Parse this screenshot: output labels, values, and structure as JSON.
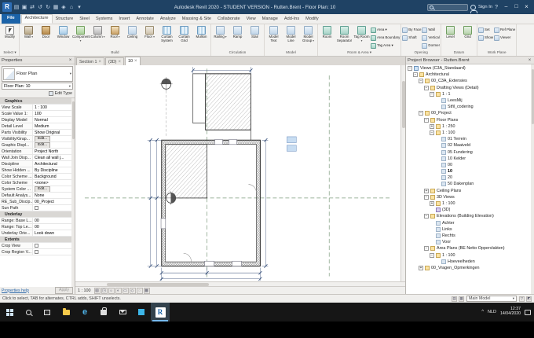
{
  "ui": {
    "close": "×",
    "dropdown": "▾",
    "help": "?"
  },
  "window": {
    "title": "Autodesk Revit 2020 - STUDENT VERSION - Rutten.Brent - Floor Plan: 10",
    "sign_in": "Sign In",
    "controls": {
      "minimize": "–",
      "maximize": "□",
      "close": "×"
    },
    "quick_access": [
      {
        "name": "revit-logo",
        "glyph": "R",
        "logo": true
      },
      {
        "name": "open-icon",
        "glyph": "▤"
      },
      {
        "name": "save-icon",
        "glyph": "▣"
      },
      {
        "name": "sync-icon",
        "glyph": "⇄"
      },
      {
        "name": "undo-icon",
        "glyph": "↺"
      },
      {
        "name": "redo-icon",
        "glyph": "↻"
      },
      {
        "name": "print-icon",
        "glyph": "▦"
      },
      {
        "name": "measure-icon",
        "glyph": "◈"
      },
      {
        "name": "home-icon",
        "glyph": "⌂"
      },
      {
        "name": "quick-access-dropdown-icon",
        "glyph": "▾"
      }
    ]
  },
  "ribbon": {
    "tabs": [
      {
        "label": "File",
        "style": "file"
      },
      {
        "label": "Architecture",
        "active": true
      },
      {
        "label": "Structure"
      },
      {
        "label": "Steel"
      },
      {
        "label": "Systems"
      },
      {
        "label": "Insert"
      },
      {
        "label": "Annotate"
      },
      {
        "label": "Analyze"
      },
      {
        "label": "Massing & Site"
      },
      {
        "label": "Collaborate"
      },
      {
        "label": "View"
      },
      {
        "label": "Manage"
      },
      {
        "label": "Add-Ins"
      },
      {
        "label": "Modify"
      }
    ],
    "panels": [
      {
        "label": "Select ▾",
        "columns": [
          {
            "type": "big",
            "buttons": [
              {
                "label": "Modify",
                "icon": "modify-cursor"
              }
            ]
          }
        ]
      },
      {
        "label": "Build",
        "columns": [
          {
            "type": "big",
            "buttons": [
              {
                "label": "Wall",
                "icon": "wall",
                "arrow": true
              }
            ]
          },
          {
            "type": "big",
            "buttons": [
              {
                "label": "Door",
                "icon": "door"
              }
            ]
          },
          {
            "type": "big",
            "buttons": [
              {
                "label": "Window",
                "icon": "window"
              }
            ]
          },
          {
            "type": "big",
            "buttons": [
              {
                "label": "Component",
                "icon": "component",
                "arrow": true
              }
            ]
          },
          {
            "type": "big",
            "buttons": [
              {
                "label": "Column",
                "icon": "column",
                "arrow": true
              }
            ]
          },
          {
            "type": "big",
            "buttons": [
              {
                "label": "Roof",
                "icon": "roof",
                "arrow": true
              }
            ]
          },
          {
            "type": "big",
            "buttons": [
              {
                "label": "Ceiling",
                "icon": "ceiling"
              }
            ]
          },
          {
            "type": "big",
            "buttons": [
              {
                "label": "Floor",
                "icon": "floor",
                "arrow": true
              }
            ]
          },
          {
            "type": "big",
            "buttons": [
              {
                "label": "Curtain System",
                "icon": "curtain-system"
              }
            ]
          },
          {
            "type": "big",
            "buttons": [
              {
                "label": "Curtain Grid",
                "icon": "curtain-grid"
              }
            ]
          },
          {
            "type": "big",
            "buttons": [
              {
                "label": "Mullion",
                "icon": "mullion"
              }
            ]
          }
        ]
      },
      {
        "label": "Circulation",
        "columns": [
          {
            "type": "big",
            "buttons": [
              {
                "label": "Railing",
                "icon": "railing",
                "arrow": true
              }
            ]
          },
          {
            "type": "big",
            "buttons": [
              {
                "label": "Ramp",
                "icon": "ramp"
              }
            ]
          },
          {
            "type": "big",
            "buttons": [
              {
                "label": "Stair",
                "icon": "stair"
              }
            ]
          }
        ]
      },
      {
        "label": "Model",
        "columns": [
          {
            "type": "big",
            "buttons": [
              {
                "label": "Model Text",
                "icon": "model-text"
              }
            ]
          },
          {
            "type": "big",
            "buttons": [
              {
                "label": "Model Line",
                "icon": "model-line"
              }
            ]
          },
          {
            "type": "big",
            "buttons": [
              {
                "label": "Model Group",
                "icon": "model-group",
                "arrow": true
              }
            ]
          }
        ]
      },
      {
        "label": "Room & Area ▾",
        "columns": [
          {
            "type": "big",
            "buttons": [
              {
                "label": "Room",
                "icon": "room"
              }
            ]
          },
          {
            "type": "big",
            "buttons": [
              {
                "label": "Room Separator",
                "icon": "room-separator"
              }
            ]
          },
          {
            "type": "big",
            "buttons": [
              {
                "label": "Tag Room",
                "icon": "tag-room",
                "arrow": true
              }
            ]
          },
          {
            "type": "stack",
            "buttons": [
              {
                "label": "Area",
                "icon": "area",
                "arrow": true
              },
              {
                "label": "Area Boundary",
                "icon": "area-boundary"
              },
              {
                "label": "Tag Area",
                "icon": "tag-area",
                "arrow": true
              }
            ]
          }
        ]
      },
      {
        "label": "Opening",
        "columns": [
          {
            "type": "stack",
            "buttons": [
              {
                "label": "By Face",
                "icon": "opening-by-face"
              },
              {
                "label": "Shaft",
                "icon": "opening-shaft"
              }
            ]
          },
          {
            "type": "stack",
            "buttons": [
              {
                "label": "Wall",
                "icon": "opening-wall"
              },
              {
                "label": "Vertical",
                "icon": "opening-vertical"
              },
              {
                "label": "Dormer",
                "icon": "opening-dormer"
              }
            ]
          }
        ]
      },
      {
        "label": "Datum",
        "columns": [
          {
            "type": "big",
            "buttons": [
              {
                "label": "Level",
                "icon": "level"
              }
            ]
          },
          {
            "type": "big",
            "buttons": [
              {
                "label": "Grid",
                "icon": "grid"
              }
            ]
          }
        ]
      },
      {
        "label": "Work Plane",
        "columns": [
          {
            "type": "stack",
            "buttons": [
              {
                "label": "Set",
                "icon": "set-work-plane"
              },
              {
                "label": "Show",
                "icon": "show-work-plane"
              }
            ]
          },
          {
            "type": "stack",
            "buttons": [
              {
                "label": "Ref Plane",
                "icon": "ref-plane"
              },
              {
                "label": "Viewer",
                "icon": "viewer"
              }
            ]
          }
        ]
      }
    ]
  },
  "properties": {
    "header": "Properties",
    "type_label": "Floor Plan",
    "instance_selector": "Floor Plan: 10",
    "edit_type": "Edit Type",
    "rows": [
      {
        "group": "Graphics"
      },
      {
        "name": "View Scale",
        "value": "1 : 100"
      },
      {
        "name": "Scale Value    1:",
        "value": "100"
      },
      {
        "name": "Display Model",
        "value": "Normal"
      },
      {
        "name": "Detail Level",
        "value": "Medium"
      },
      {
        "name": "Parts Visibility",
        "value": "Show Original"
      },
      {
        "name": "Visibility/Grap...",
        "value": "Edit...",
        "kind": "button"
      },
      {
        "name": "Graphic Displ...",
        "value": "Edit...",
        "kind": "button"
      },
      {
        "name": "Orientation",
        "value": "Project North"
      },
      {
        "name": "Wall Join Disp...",
        "value": "Clean all wall j..."
      },
      {
        "name": "Discipline",
        "value": "Architectural"
      },
      {
        "name": "Show Hidden ...",
        "value": "By Discipline"
      },
      {
        "name": "Color Scheme ...",
        "value": "Background"
      },
      {
        "name": "Color Scheme",
        "value": "<none>"
      },
      {
        "name": "System Color ...",
        "value": "Edit...",
        "kind": "button"
      },
      {
        "name": "Default Analys...",
        "value": "None"
      },
      {
        "name": "RE_Sub_Discip...",
        "value": "00_Project"
      },
      {
        "name": "Sun Path",
        "kind": "checkbox",
        "checked": false
      },
      {
        "group": "Underlay"
      },
      {
        "name": "Range: Base L...",
        "value": "00"
      },
      {
        "name": "Range: Top Le...",
        "value": "00"
      },
      {
        "name": "Underlay Orie...",
        "value": "Look down"
      },
      {
        "group": "Extents"
      },
      {
        "name": "Crop View",
        "kind": "checkbox",
        "checked": false
      },
      {
        "name": "Crop Region V...",
        "kind": "checkbox",
        "checked": false
      }
    ],
    "help": "Properties help",
    "apply": "Apply"
  },
  "view_area": {
    "tabs": [
      {
        "label": "Section 1",
        "active": false
      },
      {
        "label": "(3D)",
        "active": false
      },
      {
        "label": "10",
        "active": true
      }
    ],
    "scale": "1 : 100",
    "view_controls": [
      {
        "name": "detail-level-icon",
        "glyph": "▧"
      },
      {
        "name": "visual-style-icon",
        "glyph": "◳"
      },
      {
        "name": "sun-path-icon",
        "glyph": "☼"
      },
      {
        "name": "shadows-icon",
        "glyph": "◐"
      },
      {
        "name": "crop-view-icon",
        "glyph": "▭"
      },
      {
        "name": "crop-region-icon",
        "glyph": "◇"
      },
      {
        "name": "reveal-hidden-icon",
        "glyph": "◌"
      },
      {
        "name": "temporary-hide-icon",
        "glyph": "▩"
      }
    ]
  },
  "project_browser": {
    "header": "Project Browser - Rutten.Brent",
    "tree": [
      {
        "label": "Views (C3A_Standaard)",
        "level": 0,
        "expand": "minus",
        "icon": "views"
      },
      {
        "label": "Architectural",
        "level": 1,
        "expand": "minus",
        "icon": "folder"
      },
      {
        "label": "00_C3A_Extensies",
        "level": 2,
        "expand": "minus",
        "icon": "folder"
      },
      {
        "label": "Drafting Views (Detail)",
        "level": 3,
        "expand": "minus",
        "icon": "folder"
      },
      {
        "label": "1 : 1",
        "level": 4,
        "expand": "minus",
        "icon": "folder"
      },
      {
        "label": "LeesMij",
        "level": 5,
        "icon": "view"
      },
      {
        "label": "Stfil_codering",
        "level": 5,
        "icon": "view"
      },
      {
        "label": "00_Project",
        "level": 2,
        "expand": "minus",
        "icon": "folder"
      },
      {
        "label": "Floor Plans",
        "level": 3,
        "expand": "minus",
        "icon": "folder"
      },
      {
        "label": "1 : 250",
        "level": 4,
        "expand": "plus",
        "icon": "folder"
      },
      {
        "label": "1 : 100",
        "level": 4,
        "expand": "minus",
        "icon": "folder"
      },
      {
        "label": "01 Terrein",
        "level": 5,
        "icon": "view"
      },
      {
        "label": "02 Maaiveld",
        "level": 5,
        "icon": "view"
      },
      {
        "label": "05 Fundering",
        "level": 5,
        "icon": "view"
      },
      {
        "label": "10 Kelder",
        "level": 5,
        "icon": "view"
      },
      {
        "label": "00",
        "level": 5,
        "icon": "view"
      },
      {
        "label": "10",
        "level": 5,
        "icon": "view",
        "bold": true
      },
      {
        "label": "20",
        "level": 5,
        "icon": "view"
      },
      {
        "label": "50 Dakenplan",
        "level": 5,
        "icon": "view"
      },
      {
        "label": "Ceiling Plans",
        "level": 3,
        "expand": "plus",
        "icon": "folder"
      },
      {
        "label": "3D Views",
        "level": 3,
        "expand": "minus",
        "icon": "folder"
      },
      {
        "label": "1 : 100",
        "level": 4,
        "expand": "plus",
        "icon": "folder"
      },
      {
        "label": "(3D)",
        "level": 4,
        "icon": "view3d"
      },
      {
        "label": "Elevations (Building Elevation)",
        "level": 3,
        "expand": "minus",
        "icon": "folder"
      },
      {
        "label": "Achter",
        "level": 4,
        "icon": "view"
      },
      {
        "label": "Links",
        "level": 4,
        "icon": "view"
      },
      {
        "label": "Rechts",
        "level": 4,
        "icon": "view"
      },
      {
        "label": "Voor",
        "level": 4,
        "icon": "view"
      },
      {
        "label": "Area Plans (BE Netto Oppervlakten)",
        "level": 3,
        "expand": "minus",
        "icon": "folder"
      },
      {
        "label": "1 : 100",
        "level": 4,
        "expand": "minus",
        "icon": "folder"
      },
      {
        "label": "Hoeveelheden",
        "level": 5,
        "icon": "view"
      },
      {
        "label": "00_Vragen_Opmerkingen",
        "level": 2,
        "expand": "plus",
        "icon": "folder"
      }
    ]
  },
  "status_bar": {
    "hint": "Click to select, TAB for alternates, CTRL adds, SHIFT unselects.",
    "main_model": "Main Model",
    "left_icons": [
      {
        "name": "worksharing-icon",
        "glyph": "▤"
      },
      {
        "name": "design-options-icon",
        "glyph": "▦"
      }
    ],
    "right_icons": [
      {
        "name": "filter-icon",
        "glyph": "▽"
      },
      {
        "name": "selection-toggle-icon",
        "glyph": "◩"
      }
    ]
  },
  "taskbar": {
    "icons": [
      {
        "name": "start-button",
        "kind": "start"
      },
      {
        "name": "search-button",
        "kind": "search"
      },
      {
        "name": "task-view-button",
        "kind": "taskview"
      },
      {
        "name": "file-explorer-button",
        "kind": "explorer"
      },
      {
        "name": "edge-button",
        "kind": "edge",
        "glyph": "e"
      },
      {
        "name": "store-button",
        "kind": "store"
      },
      {
        "name": "mail-button",
        "kind": "mail"
      },
      {
        "name": "photos-button",
        "kind": "photos"
      },
      {
        "name": "revit-taskbar-button",
        "kind": "revit",
        "glyph": "R",
        "active": true
      }
    ],
    "tray": {
      "chevron": "^",
      "language": "NLD",
      "time": "12:37",
      "date": "14/04/2020"
    }
  }
}
